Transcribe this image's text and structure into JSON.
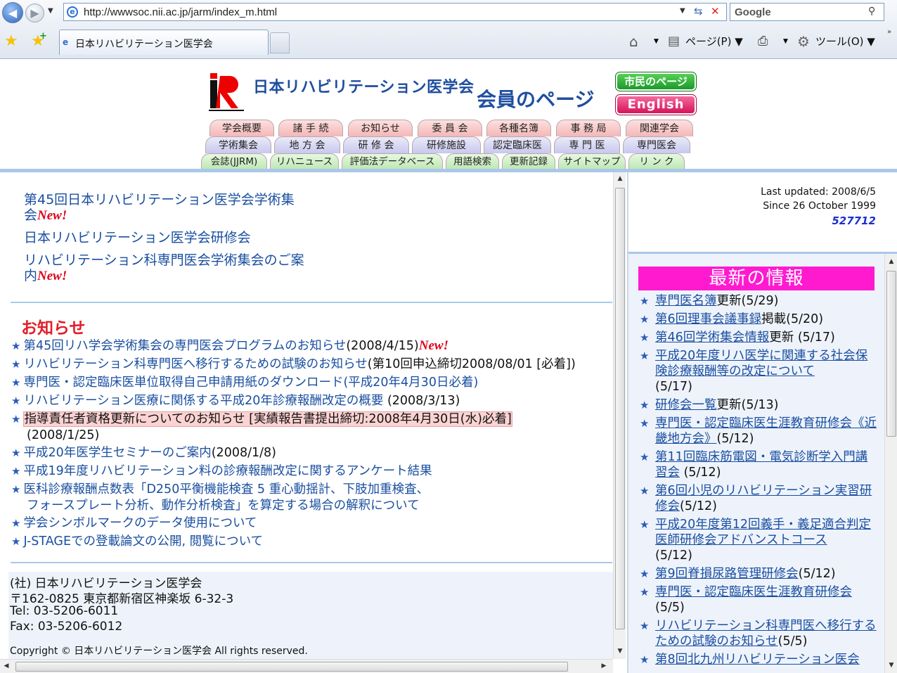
{
  "browser": {
    "url": "http://wwwsoc.nii.ac.jp/jarm/index_m.html",
    "search_placeholder": "Google",
    "tab_title": "日本リハビリテーション医学会",
    "page_menu": "ページ(P)",
    "tools_menu": "ツール(O)"
  },
  "header": {
    "site_title": "日本リハビリテーション医学会",
    "members_title": "会員のページ",
    "citizen_button": "市民のページ",
    "english_button": "English",
    "nav_row1": [
      "学会概要",
      "諸 手 続",
      "お知らせ",
      "委 員 会",
      "各種名簿",
      "事 務 局",
      "関連学会"
    ],
    "nav_row2": [
      "学術集会",
      "地 方 会",
      "研 修 会",
      "研修施設",
      "認定臨床医",
      "専 門 医",
      "専門医会"
    ],
    "nav_row3": [
      "会誌(JJRM)",
      "リハニュース",
      "評価法データベース",
      "用語検索",
      "更新記録",
      "サイトマップ",
      "リ ン ク"
    ]
  },
  "featured": [
    {
      "text": "第45回日本リハビリテーション医学会学術集会",
      "new": "New!"
    },
    {
      "text": "日本リハビリテーション医学会研修会",
      "new": ""
    },
    {
      "text": "リハビリテーション科専門医会学術集会のご案内",
      "new": "New!"
    }
  ],
  "news": {
    "heading": "お知らせ",
    "items": [
      {
        "link": "第45回リハ学会学術集会の専門医会プログラムのお知らせ",
        "after": "(2008/4/15)",
        "new": "New!"
      },
      {
        "link": "リハビリテーション科専門医へ移行するための試験のお知らせ",
        "after": "(第10回申込締切2008/08/01 [必着])"
      },
      {
        "link": "専門医・認定臨床医単位取得自己申請用紙のダウンロード(平成20年4月30日必着)",
        "after": ""
      },
      {
        "link": "リハビリテーション医療に関係する平成20年診療報酬改定の概要",
        "after": " (2008/3/13)"
      },
      {
        "link": "指導責任者資格更新についてのお知らせ [実績報告書提出締切:2008年4月30日(水)必着]",
        "after": "(2008/1/25)"
      },
      {
        "link": "平成20年医学生セミナーのご案内",
        "after": "(2008/1/8)"
      },
      {
        "link": "平成19年度リハビリテーション料の診療報酬改定に関するアンケート結果",
        "after": ""
      },
      {
        "link": "医科診療報酬点数表「D250平衡機能検査 5 重心動揺計、下肢加重検査、",
        "after": "フォースプレート分析、動作分析検査」を算定する場合の解釈について"
      },
      {
        "link": "学会シンボルマークのデータ使用について",
        "after": ""
      },
      {
        "link": "J-STAGEでの登載論文の公開, 閲覧について",
        "after": ""
      }
    ]
  },
  "footer": {
    "org": "(社) 日本リハビリテーション医学会",
    "address": "〒162-0825 東京都新宿区神楽坂 6-32-3",
    "tel": "Tel: 03-5206-6011",
    "fax": "Fax: 03-5206-6012",
    "copyright": "Copyright © 日本リハビリテーション医学会 All rights reserved."
  },
  "sidebar": {
    "last_updated": "Last updated: 2008/6/5",
    "since": "Since 26 October 1999",
    "counter": "527712",
    "heading": "最新の情報",
    "items": [
      {
        "link": "専門医名簿",
        "after": "更新(5/29)"
      },
      {
        "link": "第6回理事会議事録",
        "after": "掲載(5/20)"
      },
      {
        "link": "第46回学術集会情報",
        "after": "更新 (5/17)"
      },
      {
        "link": "平成20年度リハ医学に関連する社会保険診療報酬等の改定について",
        "after": "(5/17)"
      },
      {
        "link": "研修会一覧",
        "after": "更新(5/13)"
      },
      {
        "link": "専門医・認定臨床医生涯教育研修会《近畿地方会》",
        "after": "(5/12)"
      },
      {
        "link": "第11回臨床筋電図・電気診断学入門講習会",
        "after": " (5/12)"
      },
      {
        "link": "第6回小児のリハビリテーション実習研修会",
        "after": "(5/12)"
      },
      {
        "link": "平成20年度第12回義手・義足適合判定医師研修会アドバンストコース",
        "after": "(5/12)"
      },
      {
        "link": "第9回脊損尿路管理研修会",
        "after": "(5/12)"
      },
      {
        "link": "専門医・認定臨床医生涯教育研修会",
        "after": "(5/5)"
      },
      {
        "link": "リハビリテーション科専門医へ移行するための試験のお知らせ",
        "after": "(5/5)"
      },
      {
        "link": "第8回北九州リハビリテーション医会",
        "after": ""
      }
    ]
  }
}
